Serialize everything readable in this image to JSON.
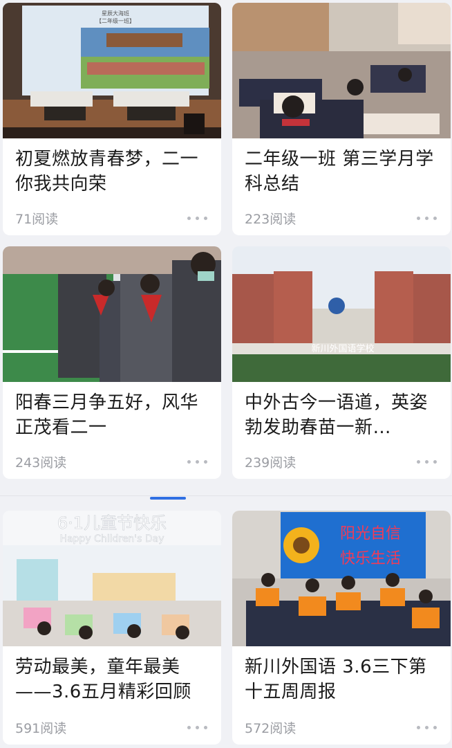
{
  "articles": [
    {
      "title": "初夏燃放青春梦，二一你我共向荣",
      "reads": "71阅读",
      "image": "stage-performance-photo",
      "image_text": {
        "line1": "星辰大海班",
        "line2": "【二年级一班】"
      }
    },
    {
      "title": "二年级一班 第三学月学科总结",
      "reads": "223阅读",
      "image": "classroom-photo"
    },
    {
      "title": "阳春三月争五好，风华正茂看二一",
      "reads": "243阅读",
      "image": "students-lineup-photo"
    },
    {
      "title": "中外古今一语道，英姿勃发助春苗一新…",
      "reads": "239阅读",
      "image": "school-building-photo",
      "image_text": {
        "sign": "新川外国语学校"
      }
    },
    {
      "title": "劳动最美，童年最美——3.6五月精彩回顾",
      "reads": "591阅读",
      "image": "childrens-day-photo",
      "image_text": {
        "banner": "6·1儿童节快乐",
        "banner_en": "Happy Children's Day"
      }
    },
    {
      "title": "新川外国语 3.6三下第十五周周报",
      "reads": "572阅读",
      "image": "award-certificates-photo",
      "image_text": {
        "line1": "阳光自信",
        "line2": "快乐生活"
      }
    }
  ],
  "colors": {
    "accent": "#2f6fe3",
    "background": "#f0f1f5",
    "card": "#ffffff",
    "meta": "#9a9ca2"
  }
}
